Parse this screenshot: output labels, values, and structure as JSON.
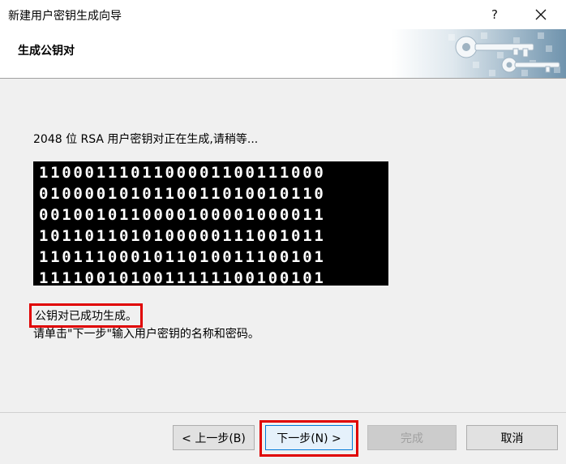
{
  "window": {
    "title": "新建用户密钥生成向导",
    "help_label": "?"
  },
  "header": {
    "title": "生成公钥对",
    "art_icon": "key-icon"
  },
  "body": {
    "status": "2048 位 RSA 用户密钥对正在生成,请稍等...",
    "binary_rows": [
      "1100011101100001100111000",
      "0100001010110011010010110",
      "0010010110000100001000011",
      "1011011010100000111001011",
      "1101110001011010011100101",
      "1111001010011111100100101"
    ],
    "success": "公钥对已成功生成。",
    "instruction": "请单击\"下一步\"输入用户密钥的名称和密码。"
  },
  "footer": {
    "back_label": "< 上一步(B)",
    "next_label": "下一步(N) >",
    "finish_label": "完成",
    "cancel_label": "取消"
  },
  "colors": {
    "highlight": "#e00000",
    "binary_background": "#000000",
    "binary_text": "#ffffff",
    "focus_border": "#0078d7"
  }
}
